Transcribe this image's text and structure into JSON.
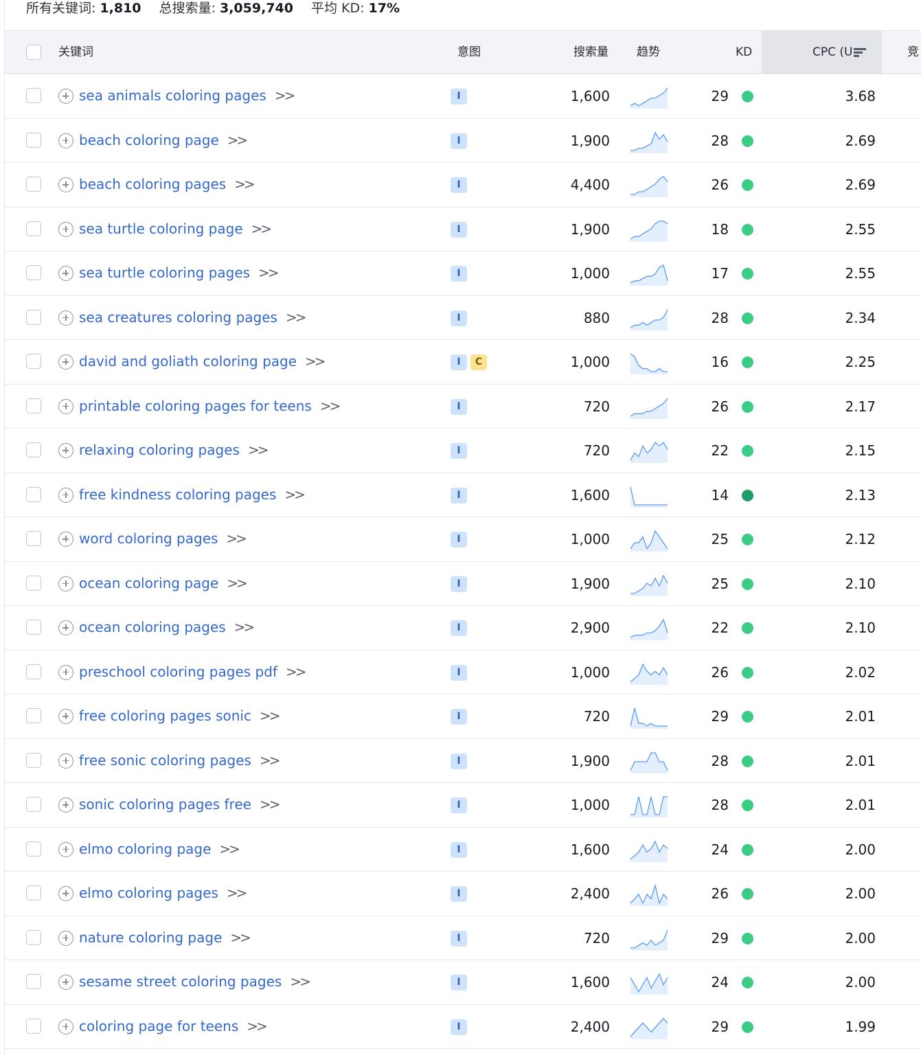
{
  "summary": {
    "keywords_label": "所有关键词:",
    "keywords_value": "1,810",
    "volume_label": "总搜索量:",
    "volume_value": "3,059,740",
    "kd_label": "平均 KD:",
    "kd_value": "17%"
  },
  "headers": {
    "keyword": "关键词",
    "intent": "意图",
    "volume": "搜索量",
    "trend": "趋势",
    "kd": "KD",
    "cpc": "CPC (U",
    "competition": "竞"
  },
  "colors": {
    "link": "#3468c9",
    "kd_easy": "#3dcc85",
    "kd_very_easy": "#1f9e6b",
    "intent_informational_bg": "#cfe2fb",
    "intent_commercial_bg": "#fbe393",
    "trend_line": "#5b9cf0"
  },
  "icons": {
    "row_add": "plus-circle-icon",
    "row_open": "double-chevron-right-icon",
    "sort": "sort-descending-icon"
  },
  "rows": [
    {
      "keyword": "sea animals coloring pages",
      "intents": [
        "I"
      ],
      "volume": "1,600",
      "trend": [
        2,
        3,
        2,
        3,
        4,
        5,
        5,
        6,
        7,
        9
      ],
      "kd": "29",
      "kd_level": "easy",
      "cpc": "3.68"
    },
    {
      "keyword": "beach coloring page",
      "intents": [
        "I"
      ],
      "volume": "1,900",
      "trend": [
        1,
        1,
        2,
        2,
        3,
        4,
        9,
        6,
        8,
        5
      ],
      "kd": "28",
      "kd_level": "easy",
      "cpc": "2.69"
    },
    {
      "keyword": "beach coloring pages",
      "intents": [
        "I"
      ],
      "volume": "4,400",
      "trend": [
        1,
        1,
        2,
        2,
        3,
        4,
        5,
        7,
        8,
        6
      ],
      "kd": "26",
      "kd_level": "easy",
      "cpc": "2.69"
    },
    {
      "keyword": "sea turtle coloring page",
      "intents": [
        "I"
      ],
      "volume": "1,900",
      "trend": [
        1,
        2,
        2,
        3,
        4,
        5,
        7,
        8,
        8,
        7
      ],
      "kd": "18",
      "kd_level": "easy",
      "cpc": "2.55"
    },
    {
      "keyword": "sea turtle coloring pages",
      "intents": [
        "I"
      ],
      "volume": "1,000",
      "trend": [
        1,
        2,
        2,
        3,
        4,
        4,
        5,
        8,
        9,
        2
      ],
      "kd": "17",
      "kd_level": "easy",
      "cpc": "2.55"
    },
    {
      "keyword": "sea creatures coloring pages",
      "intents": [
        "I"
      ],
      "volume": "880",
      "trend": [
        2,
        3,
        3,
        4,
        3,
        4,
        5,
        5,
        6,
        9
      ],
      "kd": "28",
      "kd_level": "easy",
      "cpc": "2.34"
    },
    {
      "keyword": "david and goliath coloring page",
      "intents": [
        "I",
        "C"
      ],
      "volume": "1,000",
      "trend": [
        8,
        7,
        4,
        3,
        3,
        2,
        2,
        3,
        2,
        2
      ],
      "kd": "16",
      "kd_level": "easy",
      "cpc": "2.25"
    },
    {
      "keyword": "printable coloring pages for teens",
      "intents": [
        "I"
      ],
      "volume": "720",
      "trend": [
        2,
        3,
        3,
        3,
        4,
        4,
        5,
        6,
        7,
        9
      ],
      "kd": "26",
      "kd_level": "easy",
      "cpc": "2.17"
    },
    {
      "keyword": "relaxing coloring pages",
      "intents": [
        "I"
      ],
      "volume": "720",
      "trend": [
        3,
        5,
        4,
        7,
        5,
        6,
        8,
        7,
        8,
        6
      ],
      "kd": "22",
      "kd_level": "easy",
      "cpc": "2.15"
    },
    {
      "keyword": "free kindness coloring pages",
      "intents": [
        "I"
      ],
      "volume": "1,600",
      "trend": [
        3,
        1,
        1,
        1,
        1,
        1,
        1,
        1,
        1,
        1
      ],
      "kd": "14",
      "kd_level": "very_easy",
      "cpc": "2.13"
    },
    {
      "keyword": "word coloring pages",
      "intents": [
        "I"
      ],
      "volume": "1,000",
      "trend": [
        5,
        6,
        6,
        7,
        5,
        6,
        8,
        7,
        6,
        5
      ],
      "kd": "25",
      "kd_level": "easy",
      "cpc": "2.12"
    },
    {
      "keyword": "ocean coloring page",
      "intents": [
        "I"
      ],
      "volume": "1,900",
      "trend": [
        1,
        1,
        2,
        3,
        5,
        4,
        7,
        4,
        8,
        5
      ],
      "kd": "25",
      "kd_level": "easy",
      "cpc": "2.10"
    },
    {
      "keyword": "ocean coloring pages",
      "intents": [
        "I"
      ],
      "volume": "2,900",
      "trend": [
        1,
        2,
        2,
        2,
        3,
        3,
        4,
        6,
        9,
        3
      ],
      "kd": "22",
      "kd_level": "easy",
      "cpc": "2.10"
    },
    {
      "keyword": "preschool coloring pages pdf",
      "intents": [
        "I"
      ],
      "volume": "1,000",
      "trend": [
        3,
        4,
        5,
        8,
        6,
        5,
        6,
        5,
        7,
        5
      ],
      "kd": "26",
      "kd_level": "easy",
      "cpc": "2.02"
    },
    {
      "keyword": "free coloring pages sonic",
      "intents": [
        "I"
      ],
      "volume": "720",
      "trend": [
        2,
        9,
        3,
        3,
        2,
        3,
        2,
        2,
        2,
        2
      ],
      "kd": "29",
      "kd_level": "easy",
      "cpc": "2.01"
    },
    {
      "keyword": "free sonic coloring pages",
      "intents": [
        "I"
      ],
      "volume": "1,900",
      "trend": [
        6,
        7,
        7,
        7,
        7,
        8,
        8,
        7,
        7,
        6
      ],
      "kd": "28",
      "kd_level": "easy",
      "cpc": "2.01"
    },
    {
      "keyword": "sonic coloring pages free",
      "intents": [
        "I"
      ],
      "volume": "1,000",
      "trend": [
        4,
        4,
        5,
        4,
        4,
        5,
        4,
        4,
        5,
        5
      ],
      "kd": "28",
      "kd_level": "easy",
      "cpc": "2.01"
    },
    {
      "keyword": "elmo coloring page",
      "intents": [
        "I"
      ],
      "volume": "1,600",
      "trend": [
        3,
        4,
        5,
        7,
        5,
        6,
        8,
        5,
        7,
        6
      ],
      "kd": "24",
      "kd_level": "easy",
      "cpc": "2.00"
    },
    {
      "keyword": "elmo coloring pages",
      "intents": [
        "I"
      ],
      "volume": "2,400",
      "trend": [
        5,
        6,
        7,
        5,
        7,
        6,
        9,
        5,
        7,
        6
      ],
      "kd": "26",
      "kd_level": "easy",
      "cpc": "2.00"
    },
    {
      "keyword": "nature coloring page",
      "intents": [
        "I"
      ],
      "volume": "720",
      "trend": [
        2,
        2,
        3,
        4,
        3,
        5,
        3,
        4,
        5,
        9
      ],
      "kd": "29",
      "kd_level": "easy",
      "cpc": "2.00"
    },
    {
      "keyword": "sesame street coloring pages",
      "intents": [
        "I"
      ],
      "volume": "1,600",
      "trend": [
        7,
        5,
        3,
        5,
        7,
        4,
        6,
        8,
        5,
        7
      ],
      "kd": "24",
      "kd_level": "easy",
      "cpc": "2.00"
    },
    {
      "keyword": "coloring page for teens",
      "intents": [
        "I"
      ],
      "volume": "2,400",
      "trend": [
        3,
        4,
        5,
        6,
        5,
        4,
        5,
        6,
        7,
        6
      ],
      "kd": "29",
      "kd_level": "easy",
      "cpc": "1.99"
    }
  ]
}
